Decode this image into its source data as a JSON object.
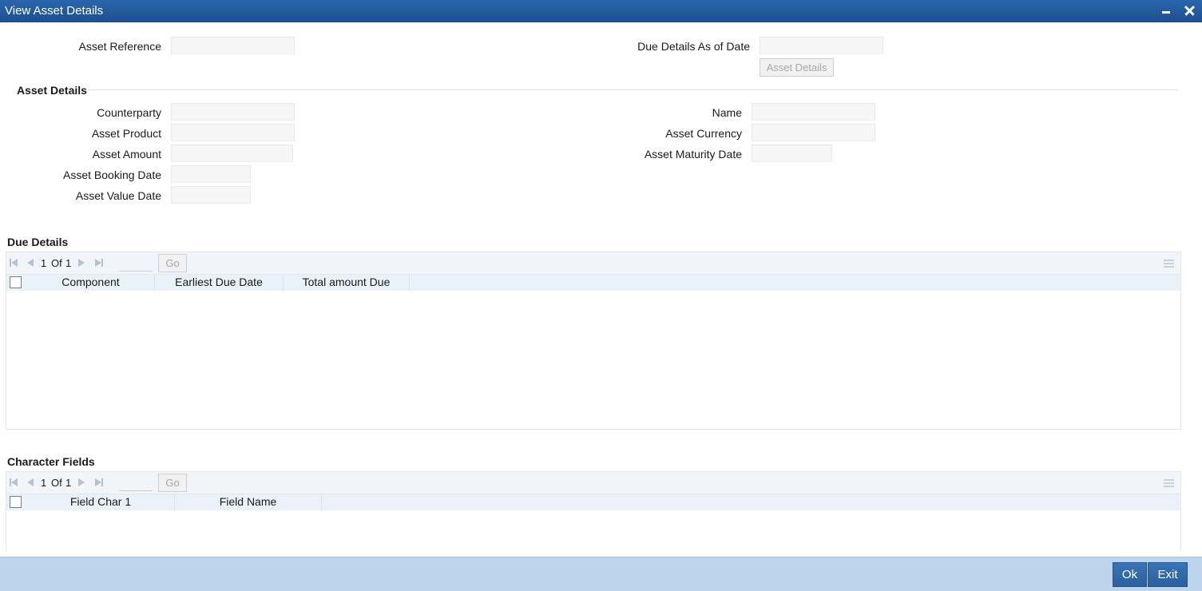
{
  "window": {
    "title": "View Asset Details"
  },
  "header_fields": {
    "asset_reference": {
      "label": "Asset Reference",
      "value": ""
    },
    "due_details_date": {
      "label": "Due Details As of Date",
      "value": ""
    },
    "asset_details_button": "Asset Details"
  },
  "asset_details": {
    "section_title": "Asset Details",
    "counterparty": {
      "label": "Counterparty",
      "value": ""
    },
    "asset_product": {
      "label": "Asset Product",
      "value": ""
    },
    "asset_amount": {
      "label": "Asset Amount",
      "value": ""
    },
    "asset_booking_date": {
      "label": "Asset Booking Date",
      "value": ""
    },
    "asset_value_date": {
      "label": "Asset Value Date",
      "value": ""
    },
    "name": {
      "label": "Name",
      "value": ""
    },
    "asset_currency": {
      "label": "Asset Currency",
      "value": ""
    },
    "asset_maturity_date": {
      "label": "Asset Maturity Date",
      "value": ""
    }
  },
  "due_details": {
    "section_title": "Due Details",
    "pager": {
      "current": "1",
      "of_label": "Of",
      "total": "1",
      "go_label": "Go"
    },
    "columns": [
      "Component",
      "Earliest Due Date",
      "Total amount Due"
    ],
    "rows": []
  },
  "character_fields": {
    "section_title": "Character Fields",
    "pager": {
      "current": "1",
      "of_label": "Of",
      "total": "1",
      "go_label": "Go"
    },
    "columns": [
      "Field Char 1",
      "Field Name"
    ],
    "rows": []
  },
  "footer": {
    "ok_label": "Ok",
    "exit_label": "Exit"
  }
}
